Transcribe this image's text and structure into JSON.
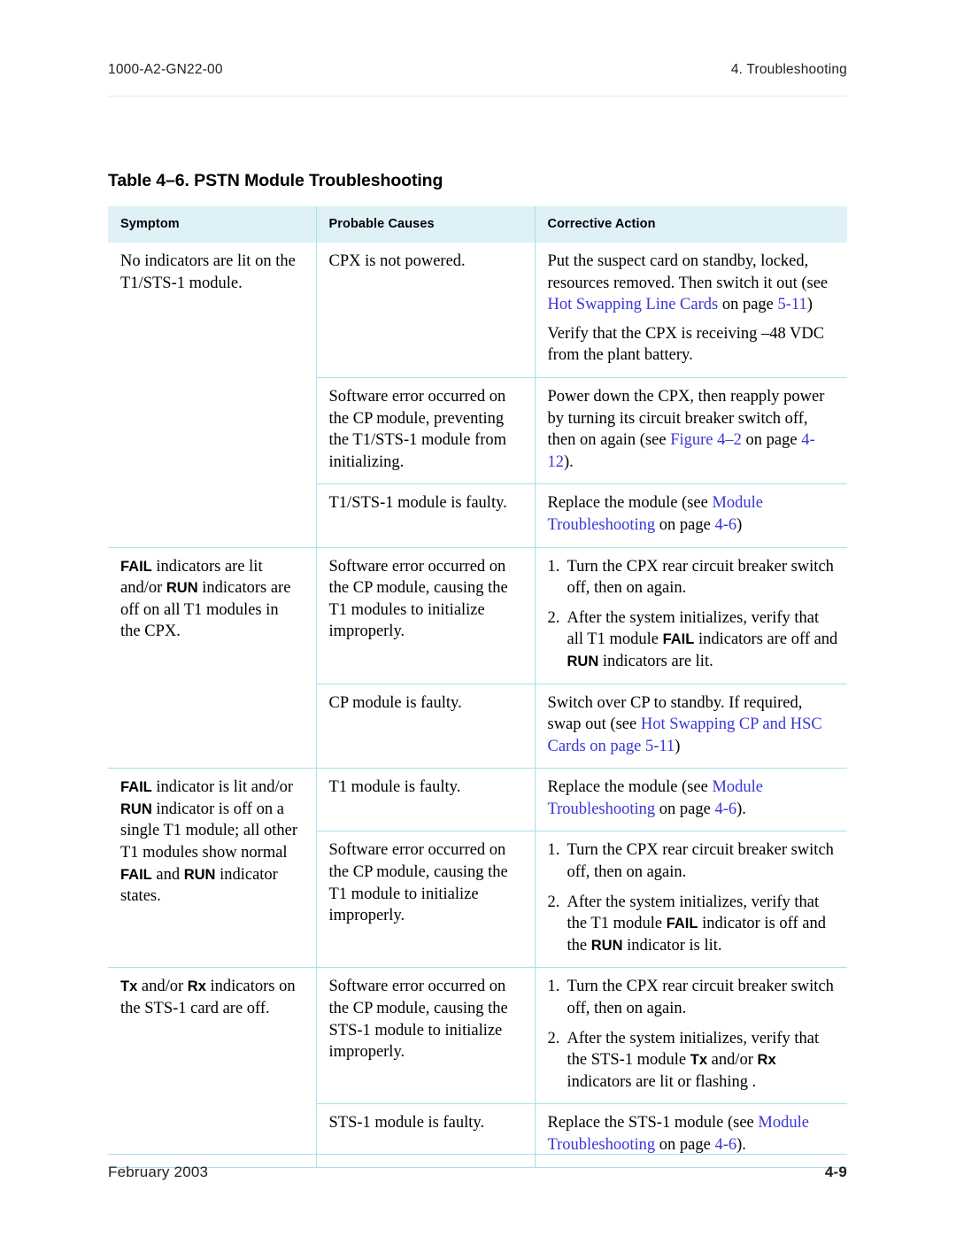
{
  "header": {
    "doc_number": "1000-A2-GN22-00",
    "chapter": "4. Troubleshooting"
  },
  "footer": {
    "date": "February 2003",
    "page_number": "4-9"
  },
  "table": {
    "caption": "Table 4–6. PSTN Module Troubleshooting",
    "columns": [
      "Symptom",
      "Probable Causes",
      "Corrective Action"
    ],
    "accent_color": "#a8dfe8",
    "header_fill": "#ddf1f7",
    "link_color": "#3b35d6",
    "groups": [
      {
        "symptom": {
          "segments": [
            {
              "text": "No indicators are lit on the T1/STS-1 module."
            }
          ]
        },
        "rows": [
          {
            "cause": [
              {
                "type": "p",
                "segments": [
                  {
                    "text": "CPX is not powered."
                  }
                ]
              }
            ],
            "action": [
              {
                "type": "p",
                "segments": [
                  {
                    "text": "Put the suspect card on standby, locked, resources removed. Then switch it out (see "
                  },
                  {
                    "text": "Hot Swapping Line Cards",
                    "style": "link"
                  },
                  {
                    "text": " on page "
                  },
                  {
                    "text": "5-11",
                    "style": "link"
                  },
                  {
                    "text": ")"
                  }
                ]
              },
              {
                "type": "p",
                "segments": [
                  {
                    "text": "Verify that the CPX is receiving –48 VDC from the plant battery."
                  }
                ]
              }
            ]
          },
          {
            "cause": [
              {
                "type": "p",
                "segments": [
                  {
                    "text": "Software error occurred on the CP module, preventing the T1/STS-1 module from initializing."
                  }
                ]
              }
            ],
            "action": [
              {
                "type": "p",
                "segments": [
                  {
                    "text": "Power down the CPX, then reapply power by turning its circuit breaker switch off, then on again (see "
                  },
                  {
                    "text": "Figure 4–2",
                    "style": "link"
                  },
                  {
                    "text": " on page "
                  },
                  {
                    "text": "4-12",
                    "style": "link"
                  },
                  {
                    "text": ")."
                  }
                ]
              }
            ]
          },
          {
            "cause": [
              {
                "type": "p",
                "segments": [
                  {
                    "text": "T1/STS-1 module is faulty."
                  }
                ]
              }
            ],
            "action": [
              {
                "type": "p",
                "segments": [
                  {
                    "text": "Replace the module (see "
                  },
                  {
                    "text": "Module Troubleshooting",
                    "style": "link"
                  },
                  {
                    "text": " on page "
                  },
                  {
                    "text": "4-6",
                    "style": "link"
                  },
                  {
                    "text": ")"
                  }
                ]
              }
            ]
          }
        ]
      },
      {
        "symptom": {
          "segments": [
            {
              "text": "FAIL",
              "style": "indicator"
            },
            {
              "text": " indicators are lit and/or "
            },
            {
              "text": "RUN",
              "style": "indicator"
            },
            {
              "text": " indicators are off on all T1 modules in the CPX."
            }
          ]
        },
        "rows": [
          {
            "cause": [
              {
                "type": "p",
                "segments": [
                  {
                    "text": "Software error occurred on the CP module, causing the T1 modules to initialize improperly."
                  }
                ]
              }
            ],
            "action": [
              {
                "type": "ol",
                "items": [
                  {
                    "num": "1.",
                    "segments": [
                      {
                        "text": "Turn the CPX rear circuit breaker switch off, then on again."
                      }
                    ]
                  },
                  {
                    "num": "2.",
                    "segments": [
                      {
                        "text": "After the system initializes, verify that all T1 module "
                      },
                      {
                        "text": "FAIL",
                        "style": "indicator"
                      },
                      {
                        "text": " indicators are off and "
                      },
                      {
                        "text": "RUN",
                        "style": "indicator"
                      },
                      {
                        "text": " indicators are lit."
                      }
                    ]
                  }
                ]
              }
            ]
          },
          {
            "cause": [
              {
                "type": "p",
                "segments": [
                  {
                    "text": "CP module is faulty."
                  }
                ]
              }
            ],
            "action": [
              {
                "type": "p",
                "segments": [
                  {
                    "text": "Switch over CP to standby. If required, swap out (see "
                  },
                  {
                    "text": "Hot Swapping CP and HSC Cards on page 5-11",
                    "style": "link"
                  },
                  {
                    "text": ")"
                  }
                ]
              }
            ]
          }
        ]
      },
      {
        "symptom": {
          "segments": [
            {
              "text": "FAIL",
              "style": "indicator"
            },
            {
              "text": " indicator is lit and/or "
            },
            {
              "text": "RUN",
              "style": "indicator"
            },
            {
              "text": " indicator is off on a single T1 module; all other T1 modules show normal "
            },
            {
              "text": "FAIL",
              "style": "indicator"
            },
            {
              "text": " and "
            },
            {
              "text": "RUN",
              "style": "indicator"
            },
            {
              "text": " indicator states."
            }
          ]
        },
        "rows": [
          {
            "cause": [
              {
                "type": "p",
                "segments": [
                  {
                    "text": "T1 module is faulty."
                  }
                ]
              }
            ],
            "action": [
              {
                "type": "p",
                "segments": [
                  {
                    "text": "Replace the module (see "
                  },
                  {
                    "text": "Module Troubleshooting",
                    "style": "link"
                  },
                  {
                    "text": " on page "
                  },
                  {
                    "text": "4-6",
                    "style": "link"
                  },
                  {
                    "text": ")."
                  }
                ]
              }
            ]
          },
          {
            "cause": [
              {
                "type": "p",
                "segments": [
                  {
                    "text": "Software error occurred on the CP module, causing the T1 module to initialize improperly."
                  }
                ]
              }
            ],
            "action": [
              {
                "type": "ol",
                "items": [
                  {
                    "num": "1.",
                    "segments": [
                      {
                        "text": "Turn the CPX rear circuit breaker switch off, then on again."
                      }
                    ]
                  },
                  {
                    "num": "2.",
                    "segments": [
                      {
                        "text": "After the system initializes, verify that the T1 module "
                      },
                      {
                        "text": "FAIL",
                        "style": "indicator"
                      },
                      {
                        "text": " indicator is off and the "
                      },
                      {
                        "text": "RUN",
                        "style": "indicator"
                      },
                      {
                        "text": " indicator is lit."
                      }
                    ]
                  }
                ]
              }
            ]
          }
        ]
      },
      {
        "symptom": {
          "segments": [
            {
              "text": "Tx",
              "style": "indicator"
            },
            {
              "text": " and/or "
            },
            {
              "text": "Rx",
              "style": "indicator"
            },
            {
              "text": " indicators on the STS-1 card are off."
            }
          ]
        },
        "rows": [
          {
            "cause": [
              {
                "type": "p",
                "segments": [
                  {
                    "text": "Software error occurred on the CP module, causing the STS-1 module to initialize improperly."
                  }
                ]
              }
            ],
            "action": [
              {
                "type": "ol",
                "items": [
                  {
                    "num": "1.",
                    "segments": [
                      {
                        "text": "Turn the CPX rear circuit breaker switch off, then on again."
                      }
                    ]
                  },
                  {
                    "num": "2.",
                    "segments": [
                      {
                        "text": "After the system initializes, verify that the STS-1 module "
                      },
                      {
                        "text": "Tx",
                        "style": "indicator"
                      },
                      {
                        "text": " and/or "
                      },
                      {
                        "text": "Rx",
                        "style": "indicator"
                      },
                      {
                        "text": " indicators are lit or flashing ."
                      }
                    ]
                  }
                ]
              }
            ]
          },
          {
            "cause": [
              {
                "type": "p",
                "segments": [
                  {
                    "text": "STS-1 module is faulty."
                  }
                ]
              }
            ],
            "action": [
              {
                "type": "p",
                "segments": [
                  {
                    "text": "Replace the STS-1 module (see "
                  },
                  {
                    "text": "Module Troubleshooting",
                    "style": "link"
                  },
                  {
                    "text": " on page "
                  },
                  {
                    "text": "4-6",
                    "style": "link"
                  },
                  {
                    "text": ")."
                  }
                ]
              }
            ]
          }
        ]
      }
    ]
  }
}
